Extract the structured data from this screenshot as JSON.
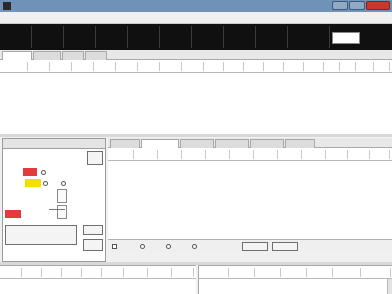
{
  "window": {
    "title": "",
    "title_buttons": [
      "",
      "",
      ""
    ]
  },
  "menu": {
    "items": [
      "",
      "",
      "",
      "",
      "",
      "",
      ""
    ]
  },
  "summary": {
    "cells": [
      {
        "label": "",
        "value": "",
        "highlight": false
      },
      {
        "label": "",
        "value": "",
        "highlight": false
      },
      {
        "label": "",
        "value": "",
        "highlight": false
      },
      {
        "label": "",
        "value": "",
        "highlight": false
      },
      {
        "label": "",
        "value": "",
        "highlight": false
      },
      {
        "label": "",
        "value": "",
        "highlight": false
      },
      {
        "label": "",
        "value": "",
        "highlight": false
      },
      {
        "label": "",
        "value": "",
        "highlight": false
      },
      {
        "label": "",
        "value": "",
        "highlight": true
      },
      {
        "label": "",
        "value": "",
        "highlight": false
      }
    ],
    "action_label": ""
  },
  "top_tabs": [
    "",
    "",
    "",
    ""
  ],
  "top_grid": {
    "columns": [
      "",
      "",
      "",
      "",
      "",
      "",
      "",
      "",
      "",
      "",
      "",
      "",
      "",
      "",
      "",
      "",
      "",
      "",
      ""
    ]
  },
  "left_panel": {
    "title": "",
    "labels": {
      "row1": "",
      "row2_left": "",
      "row2_tag": "",
      "row3_left": "",
      "row3_tag": "",
      "radio_a": "",
      "radio_b": "",
      "side_label_1": "",
      "side_label_2": "",
      "red_tag": "",
      "submit": "",
      "btn_top": "",
      "btn_mid": "",
      "btn_bottom": ""
    }
  },
  "middle_panel": {
    "tabs": [
      "",
      "",
      "",
      "",
      "",
      ""
    ],
    "columns": [
      "",
      "",
      "",
      "",
      "",
      "",
      "",
      "",
      "",
      "",
      "",
      ""
    ],
    "bottom_options": [
      "",
      "",
      "",
      ""
    ],
    "bottom_buttons": [
      "",
      ""
    ]
  },
  "bottom_left": {
    "columns": [
      "",
      "",
      "",
      "",
      "",
      "",
      "",
      "",
      ""
    ]
  },
  "bottom_right": {
    "columns": [
      "",
      "",
      "",
      "",
      "",
      "",
      ""
    ]
  },
  "colors": {
    "summary_bg": "#101010",
    "highlight_value": "#f2d300",
    "tag_red": "#e33b3b",
    "tag_yellow": "#f2e000",
    "title_bar": "#6f93b8"
  }
}
